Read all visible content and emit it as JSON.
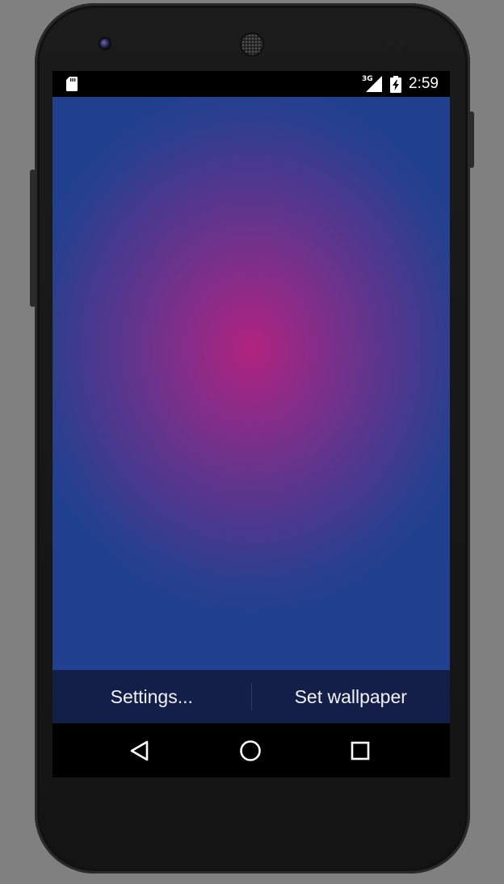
{
  "status_bar": {
    "network_type": "3G",
    "time": "2:59",
    "icons": [
      "sd-card-icon",
      "cell-signal-icon",
      "battery-charging-icon"
    ]
  },
  "wallpaper": {
    "center_color": "#b2237f",
    "edge_color": "#224090"
  },
  "action_bar": {
    "settings_label": "Settings...",
    "set_wallpaper_label": "Set wallpaper",
    "background_color": "#131f49"
  },
  "nav_bar": {
    "icons": [
      "back-icon",
      "home-icon",
      "recents-icon"
    ]
  }
}
